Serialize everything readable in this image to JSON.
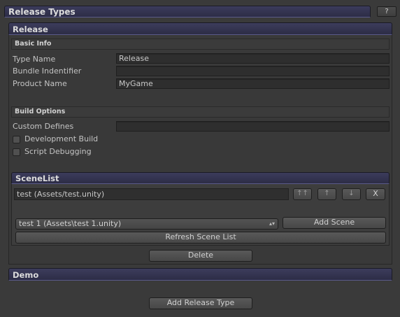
{
  "window": {
    "title": "Release Types",
    "help_label": "?"
  },
  "release": {
    "title": "Release",
    "basic_info": {
      "title": "Basic Info",
      "fields": [
        {
          "label": "Type Name",
          "value": "Release"
        },
        {
          "label": "Bundle Indentifier",
          "value": ""
        },
        {
          "label": "Product Name",
          "value": "MyGame"
        }
      ]
    },
    "build_options": {
      "title": "Build Options",
      "custom_defines_label": "Custom Defines",
      "custom_defines_value": "",
      "checkboxes": [
        {
          "label": "Development Build",
          "checked": false
        },
        {
          "label": "Script Debugging",
          "checked": false
        }
      ]
    },
    "scene_list": {
      "title": "SceneList",
      "scenes": [
        "test (Assets/test.unity)"
      ],
      "row_buttons": {
        "top": "↑↑",
        "up": "↑",
        "down": "↓",
        "remove": "X"
      },
      "selected_scene": "test 1 (Assets\\test 1.unity)",
      "add_scene_label": "Add Scene",
      "refresh_label": "Refresh Scene List"
    },
    "delete_label": "Delete"
  },
  "demo": {
    "title": "Demo"
  },
  "add_release_type_label": "Add Release Type"
}
